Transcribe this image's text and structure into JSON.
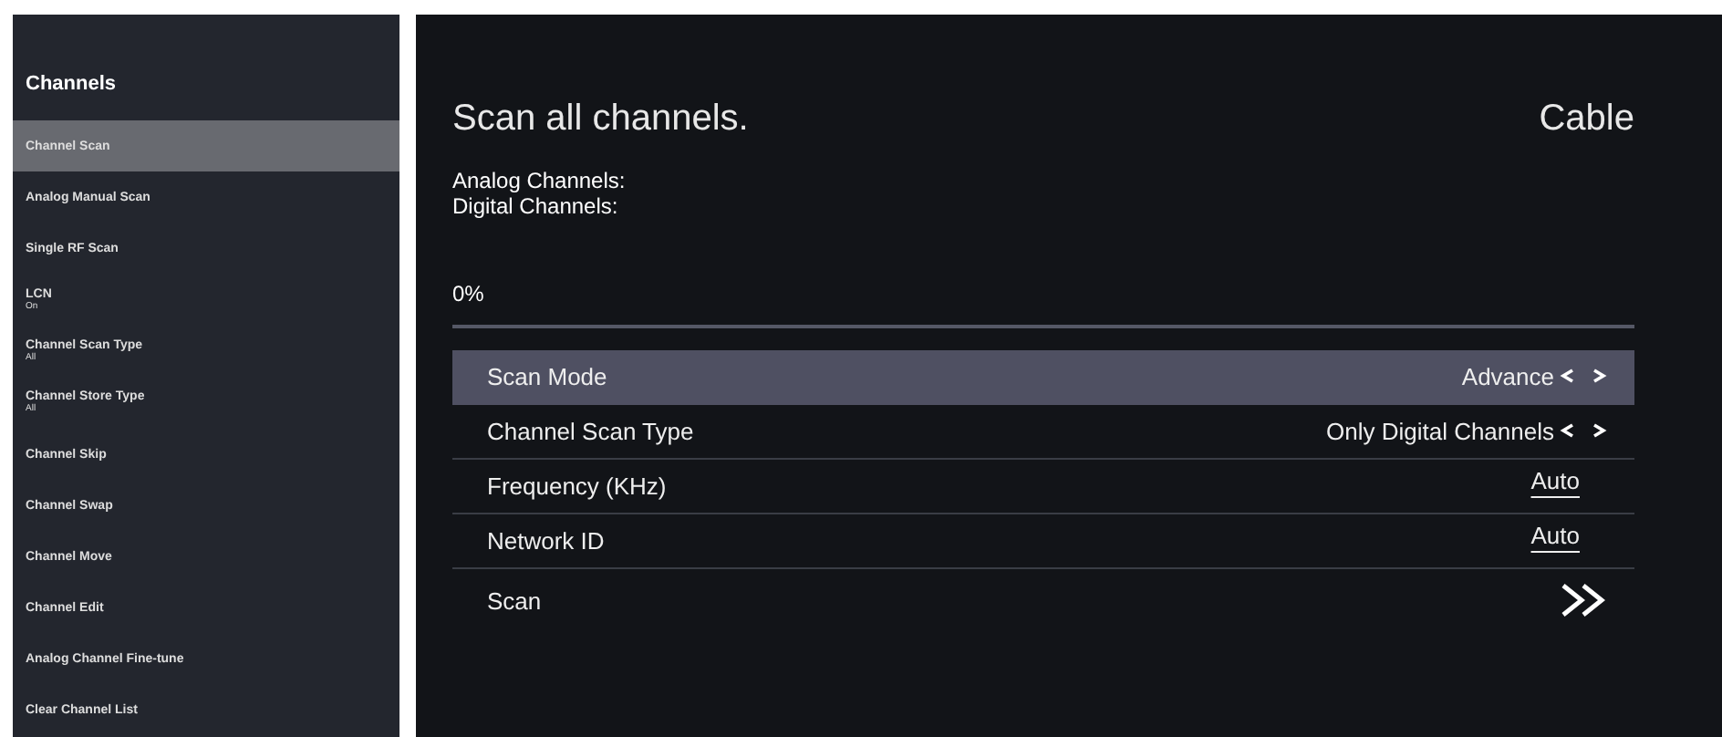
{
  "sidebar": {
    "title": "Channels",
    "items": [
      {
        "label": "Channel Scan",
        "selected": true
      },
      {
        "label": "Analog Manual Scan",
        "selected": false
      },
      {
        "label": "Single RF Scan",
        "selected": false
      },
      {
        "label": "LCN",
        "subtitle": "On",
        "selected": false
      },
      {
        "label": "Channel Scan Type",
        "subtitle": "All",
        "selected": false
      },
      {
        "label": "Channel Store Type",
        "subtitle": "All",
        "selected": false
      },
      {
        "label": "Channel Skip",
        "selected": false
      },
      {
        "label": "Channel Swap",
        "selected": false
      },
      {
        "label": "Channel Move",
        "selected": false
      },
      {
        "label": "Channel Edit",
        "selected": false
      },
      {
        "label": "Analog Channel Fine-tune",
        "selected": false
      },
      {
        "label": "Clear Channel List",
        "selected": false
      }
    ]
  },
  "main": {
    "title": "Scan all channels.",
    "source": "Cable",
    "counts": [
      "Analog Channels:",
      "Digital Channels:"
    ],
    "progress": {
      "reading": "0%"
    },
    "rows": [
      {
        "kind": "select",
        "label": "Scan Mode",
        "value": "Advance",
        "selected": true
      },
      {
        "kind": "select",
        "label": "Channel Scan Type",
        "value": "Only Digital Channels",
        "selected": false
      },
      {
        "kind": "field",
        "label": "Frequency (KHz)",
        "value": "Auto",
        "selected": false
      },
      {
        "kind": "field",
        "label": "Network ID",
        "value": "Auto",
        "selected": false
      },
      {
        "kind": "action",
        "label": "Scan",
        "selected": false
      }
    ]
  }
}
